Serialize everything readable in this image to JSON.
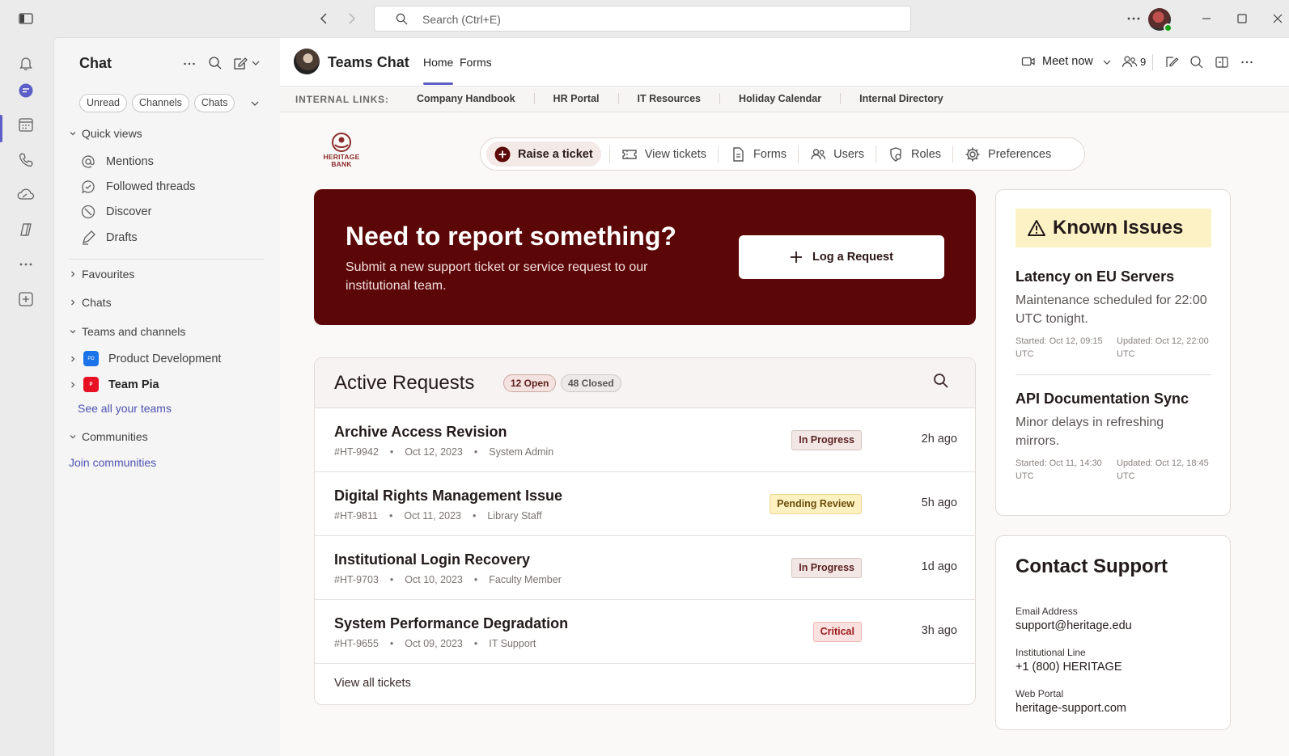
{
  "titlebar": {
    "search_placeholder": "Search (Ctrl+E)"
  },
  "chat_pane": {
    "title": "Chat",
    "filters": [
      "Unread",
      "Channels",
      "Chats"
    ],
    "quick_views_label": "Quick views",
    "quick_views": [
      {
        "label": "Mentions",
        "icon": "at-icon"
      },
      {
        "label": "Followed threads",
        "icon": "followed-threads-icon"
      },
      {
        "label": "Discover",
        "icon": "discover-icon"
      },
      {
        "label": "Drafts",
        "icon": "drafts-icon"
      }
    ],
    "favourites_label": "Favourites",
    "chats_label": "Chats",
    "teams_label": "Teams and channels",
    "teams": [
      {
        "name": "Product Development",
        "initials": "PD",
        "color": "#1a73e8"
      },
      {
        "name": "Team Pia",
        "initials": "P",
        "color": "#e81123"
      }
    ],
    "see_all_teams": "See all your teams",
    "communities_label": "Communities",
    "join_communities": "Join communities"
  },
  "header": {
    "title": "Teams Chat",
    "tabs": [
      "Home",
      "Forms"
    ],
    "meet_now": "Meet now",
    "participants_count": "9"
  },
  "internal_links": {
    "label": "INTERNAL LINKS:",
    "links": [
      "Company Handbook",
      "HR Portal",
      "IT Resources",
      "Holiday Calendar",
      "Internal Directory"
    ]
  },
  "logo": {
    "line1": "HERITAGE",
    "line2": "BANK"
  },
  "nav": {
    "items": [
      "Raise a ticket",
      "View tickets",
      "Forms",
      "Users",
      "Roles",
      "Preferences"
    ]
  },
  "hero": {
    "title": "Need to report something?",
    "subtitle": "Submit a new support ticket or service request to our institutional team.",
    "button": "Log a Request"
  },
  "requests": {
    "title": "Active Requests",
    "open_badge": "12 Open",
    "closed_badge": "48 Closed",
    "rows": [
      {
        "title": "Archive Access Revision",
        "id": "#HT-9942",
        "date": "Oct 12, 2023",
        "who": "System Admin",
        "status": "In Progress",
        "ago": "2h ago"
      },
      {
        "title": "Digital Rights Management Issue",
        "id": "#HT-9811",
        "date": "Oct 11, 2023",
        "who": "Library Staff",
        "status": "Pending Review",
        "ago": "5h ago"
      },
      {
        "title": "Institutional Login Recovery",
        "id": "#HT-9703",
        "date": "Oct 10, 2023",
        "who": "Faculty Member",
        "status": "In Progress",
        "ago": "1d ago"
      },
      {
        "title": "System Performance Degradation",
        "id": "#HT-9655",
        "date": "Oct 09, 2023",
        "who": "IT Support",
        "status": "Critical",
        "ago": "3h ago"
      }
    ],
    "view_all": "View all tickets"
  },
  "known_issues": {
    "title": "Known Issues",
    "items": [
      {
        "title": "Latency on EU Servers",
        "desc": "Maintenance scheduled for 22:00 UTC tonight.",
        "started": "Started: Oct 12, 09:15 UTC",
        "updated": "Updated: Oct 12, 22:00 UTC"
      },
      {
        "title": "API Documentation Sync",
        "desc": "Minor delays in refreshing mirrors.",
        "started": "Started: Oct 11, 14:30 UTC",
        "updated": "Updated: Oct 12, 18:45 UTC"
      }
    ]
  },
  "contact": {
    "title": "Contact Support",
    "email_label": "Email Address",
    "email": "support@heritage.edu",
    "line_label": "Institutional Line",
    "line": "+1 (800) HERITAGE",
    "portal_label": "Web Portal",
    "portal": "heritage-support.com"
  }
}
